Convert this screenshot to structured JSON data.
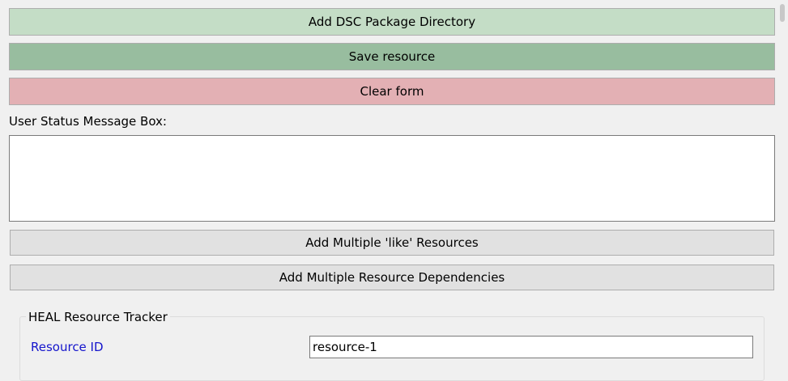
{
  "buttons": {
    "add_dsc": "Add DSC Package Directory",
    "save": "Save resource",
    "clear": "Clear form",
    "add_like": "Add Multiple 'like' Resources",
    "add_deps": "Add Multiple Resource Dependencies"
  },
  "status": {
    "label": "User Status Message Box:",
    "message": ""
  },
  "tracker": {
    "title": "HEAL Resource Tracker",
    "resource_id_label": "Resource ID",
    "resource_id_value": "resource-1"
  },
  "colors": {
    "add_dsc_bg": "#c4ddc6",
    "save_bg": "#98bd9f",
    "clear_bg": "#e3b0b4",
    "link_label": "#1515cc"
  }
}
